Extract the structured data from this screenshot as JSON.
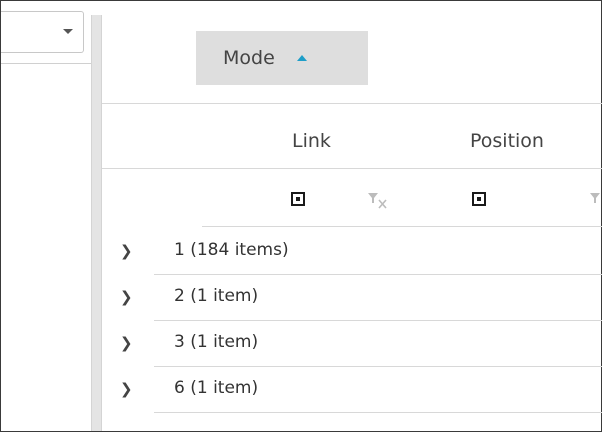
{
  "group_panel": {
    "chip_label": "Mode",
    "sort": "ascending"
  },
  "columns": [
    {
      "label": "Link"
    },
    {
      "label": "Position"
    }
  ],
  "groups": [
    {
      "label": "1 (184 items)"
    },
    {
      "label": "2 (1 item)"
    },
    {
      "label": "3 (1 item)"
    },
    {
      "label": "6 (1 item)"
    }
  ],
  "icons": {
    "combo": "chevron-down-icon",
    "sort": "sort-ascending-icon",
    "filter_clear": "filter-clear-icon",
    "expand": "chevron-right-icon"
  },
  "colors": {
    "accent": "#1e9ec8",
    "chip_bg": "#dedede"
  }
}
